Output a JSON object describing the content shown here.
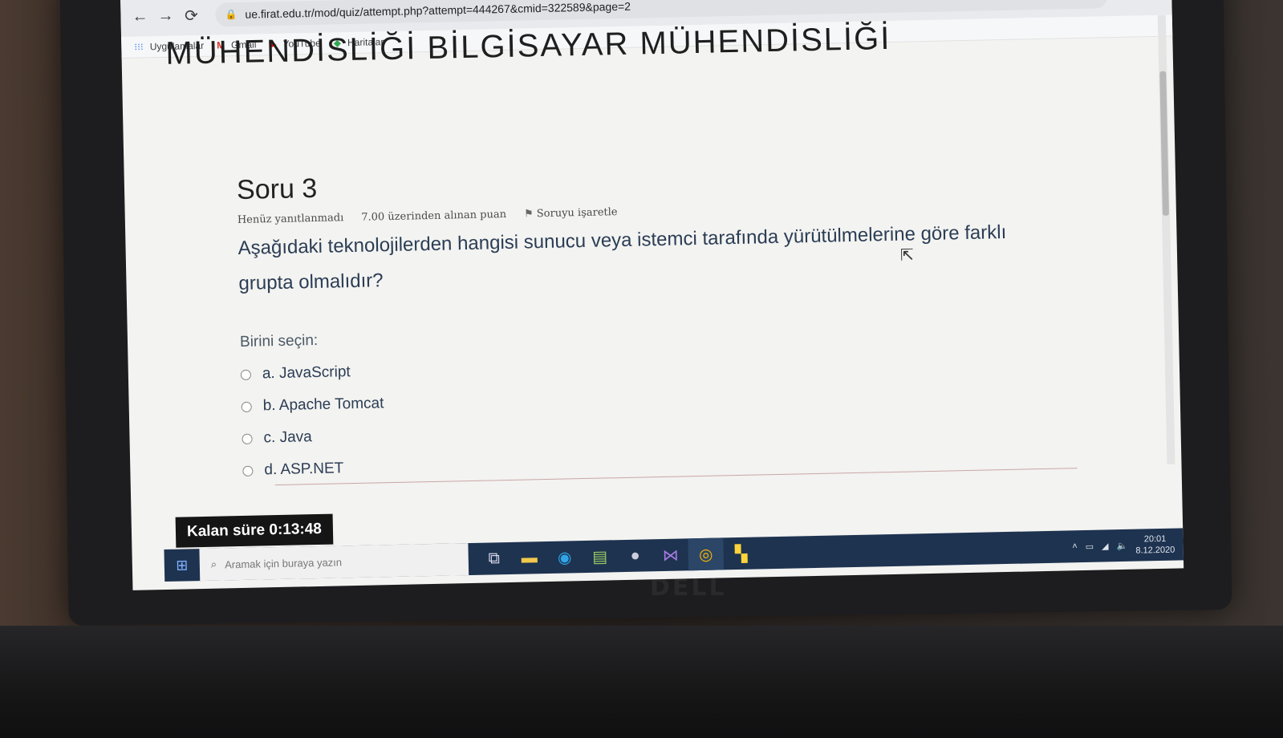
{
  "browser": {
    "url": "ue.firat.edu.tr/mod/quiz/attempt.php?attempt=444267&cmid=322589&page=2",
    "bookmarks": [
      {
        "label": "Uygulamalar",
        "icon": "apps-grid-icon"
      },
      {
        "label": "Gmail",
        "icon": "gmail-icon"
      },
      {
        "label": "YouTube",
        "icon": "youtube-icon"
      },
      {
        "label": "Haritalar",
        "icon": "maps-icon"
      }
    ]
  },
  "page": {
    "header": "MÜHENDİSLİĞİ BİLGİSAYAR MÜHENDİSLİĞİ"
  },
  "question": {
    "title": "Soru 3",
    "status": "Henüz yanıtlanmadı",
    "points": "7.00 üzerinden alınan puan",
    "flag_label": "Soruyu işaretle",
    "text": "Aşağıdaki teknolojilerden hangisi sunucu veya istemci tarafında yürütülmelerine göre farklı grupta olmalıdır?",
    "prompt": "Birini seçin:",
    "options": [
      "a. JavaScript",
      "b. Apache Tomcat",
      "c. Java",
      "d. ASP.NET"
    ]
  },
  "timer": {
    "label": "Kalan süre",
    "value": "0:13:48"
  },
  "taskbar": {
    "search_placeholder": "Aramak için buraya yazın",
    "time": "20:01",
    "date": "8.12.2020"
  }
}
